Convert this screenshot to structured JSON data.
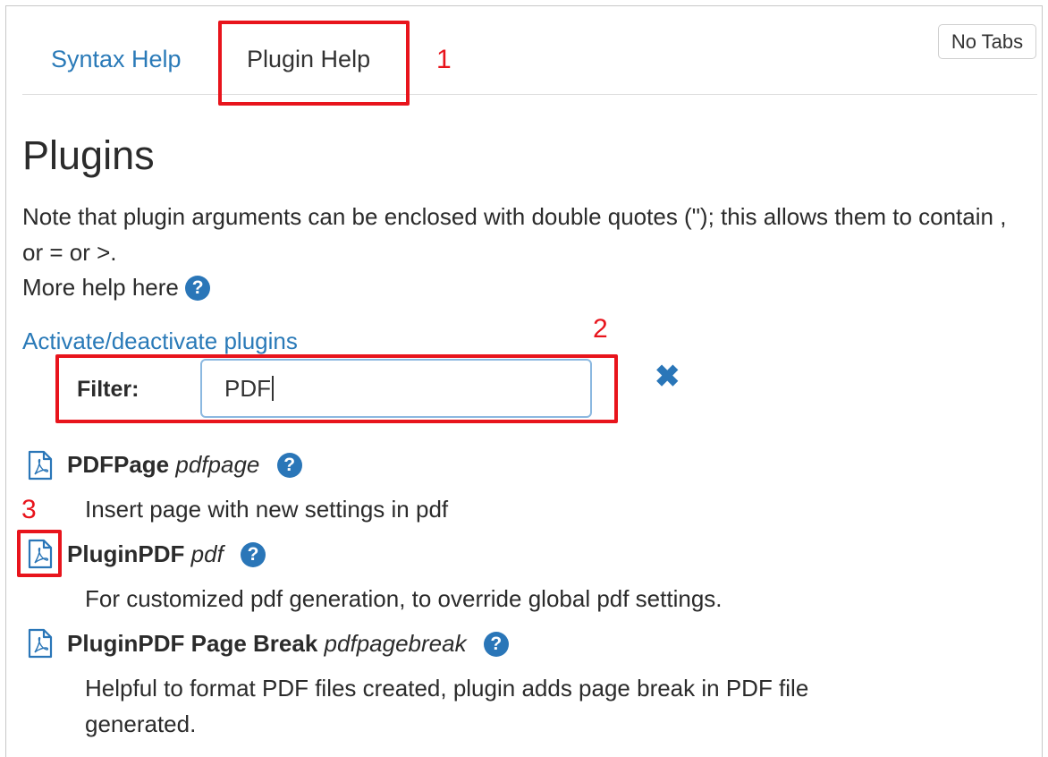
{
  "tabs": [
    {
      "label": "Syntax Help"
    },
    {
      "label": "Plugin Help"
    }
  ],
  "no_tabs_button": "No Tabs",
  "page_title": "Plugins",
  "note": "Note that plugin arguments can be enclosed with double quotes (\"); this allows them to contain , or = or >.",
  "more_help": "More help here",
  "help_glyph": "?",
  "activate_link": "Activate/deactivate plugins",
  "filter": {
    "label": "Filter:",
    "value": "PDF"
  },
  "clear_glyph": "✖",
  "plugins": [
    {
      "name": "PDFPage",
      "code": "pdfpage",
      "description": "Insert page with new settings in pdf"
    },
    {
      "name": "PluginPDF",
      "code": "pdf",
      "description": "For customized pdf generation, to override global pdf settings."
    },
    {
      "name": "PluginPDF Page Break",
      "code": "pdfpagebreak",
      "description": "Helpful to format PDF files created, plugin adds page break in PDF file generated."
    }
  ],
  "annotations": [
    "1",
    "2",
    "3"
  ],
  "colors": {
    "link": "#2a7ab8",
    "icon": "#2a76b8",
    "annotation": "#e8141c"
  },
  "icons": {
    "help": "question-circle-icon",
    "clear": "close-icon",
    "plugin": "pdf-file-icon"
  }
}
